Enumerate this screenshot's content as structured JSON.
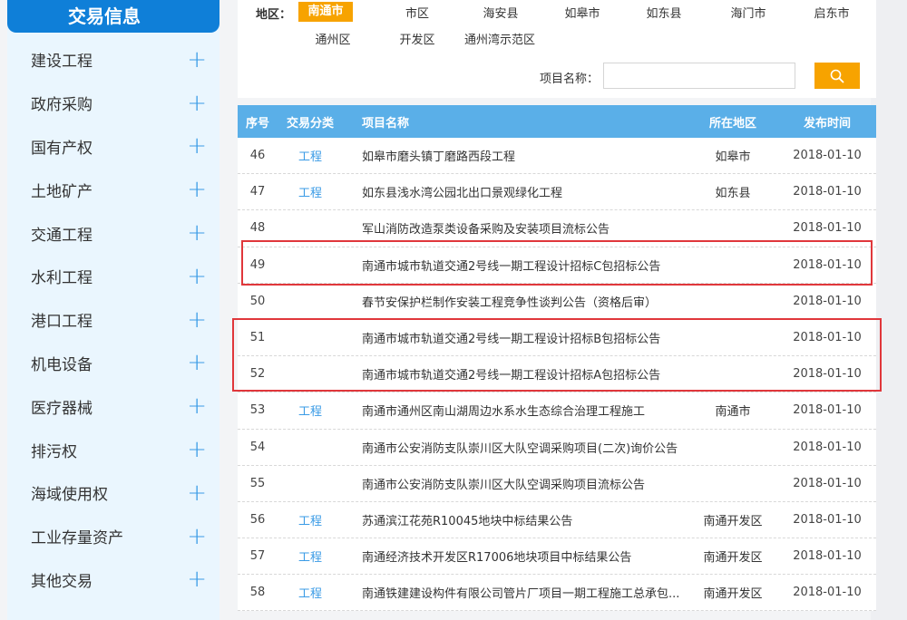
{
  "sidebar": {
    "title": "交易信息",
    "items": [
      {
        "label": "建设工程"
      },
      {
        "label": "政府采购"
      },
      {
        "label": "国有产权"
      },
      {
        "label": "土地矿产"
      },
      {
        "label": "交通工程"
      },
      {
        "label": "水利工程"
      },
      {
        "label": "港口工程"
      },
      {
        "label": "机电设备"
      },
      {
        "label": "医疗器械"
      },
      {
        "label": "排污权"
      },
      {
        "label": "海域使用权"
      },
      {
        "label": "工业存量资产"
      },
      {
        "label": "其他交易"
      }
    ],
    "plus_symbol": "+"
  },
  "filter": {
    "region_label": "地区：",
    "regions": [
      "南通市",
      "市区",
      "海安县",
      "如皋市",
      "如东县",
      "海门市",
      "启东市",
      "通州区",
      "开发区",
      "通州湾示范区"
    ],
    "active_region": "南通市",
    "name_label": "项目名称：",
    "name_value": ""
  },
  "table": {
    "headers": [
      "序号",
      "交易分类",
      "项目名称",
      "所在地区",
      "发布时间"
    ],
    "rows": [
      [
        "46",
        "工程",
        "如皋市磨头镇丁磨路西段工程",
        "如皋市",
        "2018-01-10"
      ],
      [
        "47",
        "工程",
        "如东县浅水湾公园北出口景观绿化工程",
        "如东县",
        "2018-01-10"
      ],
      [
        "48",
        "",
        "军山消防改造泵类设备采购及安装项目流标公告",
        "",
        "2018-01-10"
      ],
      [
        "49",
        "",
        "南通市城市轨道交通2号线一期工程设计招标C包招标公告",
        "",
        "2018-01-10"
      ],
      [
        "50",
        "",
        "春节安保护栏制作安装工程竞争性谈判公告（资格后审）",
        "",
        "2018-01-10"
      ],
      [
        "51",
        "",
        "南通市城市轨道交通2号线一期工程设计招标B包招标公告",
        "",
        "2018-01-10"
      ],
      [
        "52",
        "",
        "南通市城市轨道交通2号线一期工程设计招标A包招标公告",
        "",
        "2018-01-10"
      ],
      [
        "53",
        "工程",
        "南通市通州区南山湖周边水系水生态综合治理工程施工",
        "南通市",
        "2018-01-10"
      ],
      [
        "54",
        "",
        "南通市公安消防支队崇川区大队空调采购项目(二次)询价公告",
        "",
        "2018-01-10"
      ],
      [
        "55",
        "",
        "南通市公安消防支队崇川区大队空调采购项目流标公告",
        "",
        "2018-01-10"
      ],
      [
        "56",
        "工程",
        "苏通滨江花苑R10045地块中标结果公告",
        "南通开发区",
        "2018-01-10"
      ],
      [
        "57",
        "工程",
        "南通经济技术开发区R17006地块项目中标结果公告",
        "南通开发区",
        "2018-01-10"
      ],
      [
        "58",
        "工程",
        "南通铁建建设构件有限公司管片厂项目一期工程施工总承包...",
        "南通开发区",
        "2018-01-10"
      ]
    ]
  },
  "colors": {
    "brand_blue": "#0f7fd8",
    "header_blue": "#5aafe8",
    "accent_orange": "#f7a300",
    "highlight_red": "#e0373b"
  }
}
